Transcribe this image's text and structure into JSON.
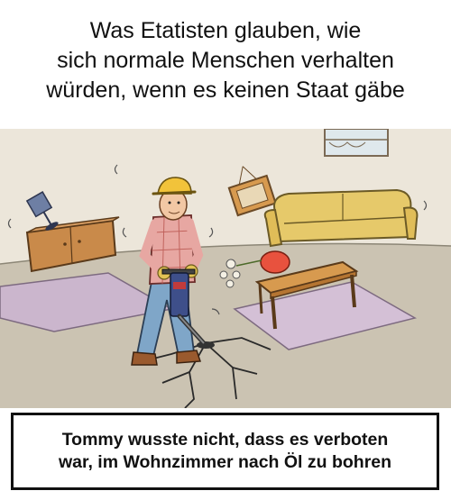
{
  "meme": {
    "title_lines": [
      "Was Etatisten glauben, wie",
      "sich normale Menschen verhalten",
      "würden, wenn es keinen Staat gäbe"
    ],
    "caption_lines": [
      "Tommy wusste nicht, dass es verboten",
      "war, im Wohnzimmer nach Öl zu bohren"
    ]
  },
  "illustration": {
    "scene": "cartoon-living-room",
    "icons": [
      "worker-figure",
      "jackhammer-icon",
      "hard-hat-icon",
      "sofa-icon",
      "table-icon",
      "lamp-icon",
      "picture-frame-icon",
      "flower-vase-icon",
      "rug-icon",
      "floor-crack-icon"
    ],
    "colors": {
      "wall": "#ece6da",
      "floor": "#c9c0ae",
      "rug": "#cbb6cd",
      "sofa": "#e6c96a",
      "furniture": "#c98a4a",
      "helmet": "#f2c33a",
      "vase": "#e8523e",
      "jeans": "#7fa6c8"
    }
  }
}
